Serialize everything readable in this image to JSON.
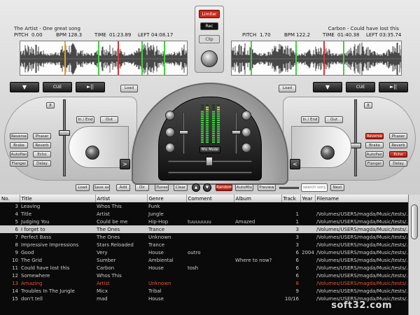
{
  "deck_left": {
    "song": "The Artist - One great song",
    "pitch_label": "PITCH",
    "pitch_value": "0.00",
    "bpm_label": "BPM",
    "bpm_value": "128.3",
    "time_label": "TIME",
    "time_value": "01:23.89",
    "left_label": "LEFT",
    "left_value": "04:08.17",
    "transport": {
      "eject": "▼",
      "cue": "CUE",
      "play": "►||",
      "load": "Load"
    },
    "cue_small": "8",
    "inout": {
      "in_end": "In / End",
      "out": "Out"
    },
    "effects_left": [
      "Reverse",
      "Brake",
      "AutoPan",
      "Flanger"
    ],
    "effects_right": [
      "Phaser",
      "Reverb",
      "Echo",
      "Delay"
    ],
    "nudge": ">"
  },
  "deck_right": {
    "song": "Carbon - Could have lost this",
    "pitch_label": "PITCH",
    "pitch_value": "1.70",
    "bpm_label": "BPM",
    "bpm_value": "122.2",
    "time_label": "TIME",
    "time_value": "01:40.38",
    "left_label": "LEFT",
    "left_value": "03:35.74",
    "transport": {
      "eject": "▼",
      "cue": "CUE",
      "play": "►||",
      "load": "Load"
    },
    "cue_small": "8",
    "inout": {
      "in_end": "In / End",
      "out": "Out"
    },
    "effects_left": [
      "Reverse",
      "Brake",
      "AutoPan",
      "Flanger"
    ],
    "effects_right": [
      "Phaser",
      "Reverb",
      "Echo",
      "Delay"
    ],
    "effects_active": [
      "Reverse",
      "Echo"
    ],
    "nudge": "<"
  },
  "center": {
    "limiter": "Limiter",
    "rec": "Rec",
    "clip": "Clip",
    "mic_mode": "Mic Mode"
  },
  "toolbar": {
    "load": "Load",
    "save": "Save as",
    "add": "Add",
    "dir": "Dir",
    "itunes": "iTunes",
    "clear": "Clear",
    "up": "▲",
    "down": "▼",
    "random": "Random",
    "automix": "AutoMix",
    "preview": "Preview",
    "search_placeholder": "search song",
    "next": "Next"
  },
  "playlist": {
    "columns": [
      "No.",
      "Title",
      "Artist",
      "Genre",
      "Comment",
      "Album",
      "Track",
      "Year",
      "Filename"
    ],
    "rows": [
      {
        "no": "3",
        "title": "Leaving",
        "artist": "Whos This",
        "genre": "Funk",
        "comment": "",
        "album": "",
        "track": "",
        "year": "",
        "file": ""
      },
      {
        "no": "4",
        "title": "Title",
        "artist": "Artist",
        "genre": "Jungle",
        "comment": "",
        "album": "",
        "track": "1",
        "year": "",
        "file": "/Volumes/USERS/magda/Music/tests/..."
      },
      {
        "no": "5",
        "title": "Judging You",
        "artist": "Could be me",
        "genre": "Hip-Hop",
        "comment": "tuuuuuuu",
        "album": "Amazed",
        "track": "1",
        "year": "",
        "file": "/Volumes/USERS/magda/Music/tests/..."
      },
      {
        "no": "6",
        "title": "I forget to",
        "artist": "The Ones",
        "genre": "Trance",
        "comment": "",
        "album": "",
        "track": "3",
        "year": "",
        "file": "/Volumes/USERS/magda/Music/tests/..."
      },
      {
        "no": "7",
        "title": "Perfect Bass",
        "artist": "The Ones",
        "genre": "Unknown",
        "comment": "",
        "album": "",
        "track": "3",
        "year": "",
        "file": "/Volumes/USERS/magda/Music/tests/..."
      },
      {
        "no": "8",
        "title": "Impressive Impressions",
        "artist": "Stars Reloaded",
        "genre": "Trance",
        "comment": "",
        "album": "",
        "track": "3",
        "year": "",
        "file": "/Volumes/USERS/magda/Music/tests/..."
      },
      {
        "no": "9",
        "title": "Good",
        "artist": "Very",
        "genre": "House",
        "comment": "outro",
        "album": "",
        "track": "6",
        "year": "2004",
        "file": "/Volumes/USERS/magda/Music/tests/..."
      },
      {
        "no": "10",
        "title": "The Grid",
        "artist": "Sumber",
        "genre": "Ambiental",
        "comment": "",
        "album": "Where to now?",
        "track": "6",
        "year": "",
        "file": "/Volumes/USERS/magda/Music/tests/..."
      },
      {
        "no": "11",
        "title": "Could have lost this",
        "artist": "Carbon",
        "genre": "House",
        "comment": "tosh",
        "album": "",
        "track": "6",
        "year": "",
        "file": "/Volumes/USERS/magda/Music/tests/..."
      },
      {
        "no": "12",
        "title": "Somewhere",
        "artist": "Whos This",
        "genre": "",
        "comment": "",
        "album": "",
        "track": "6",
        "year": "",
        "file": "/Volumes/USERS/magda/Music/tests/..."
      },
      {
        "no": "13",
        "title": "Amazing",
        "artist": "Artist",
        "genre": "Unknown",
        "comment": "",
        "album": "",
        "track": "8",
        "year": "",
        "file": "/Volumes/USERS/magda/Music/tests/..."
      },
      {
        "no": "14",
        "title": "Troubles In The Jungle",
        "artist": "Micx",
        "genre": "Tribal",
        "comment": "",
        "album": "",
        "track": "9",
        "year": "",
        "file": "/Volumes/USERS/magda/Music/tests/..."
      },
      {
        "no": "15",
        "title": "don't tell",
        "artist": "mad",
        "genre": "House",
        "comment": "",
        "album": "",
        "track": "10/16",
        "year": "",
        "file": "/Volumes/USERS/magda/Music/tests/..."
      }
    ],
    "selected_row": 3,
    "playing_row": 10
  },
  "watermark": "soft32.com",
  "colors": {
    "accent_red": "#c9281c",
    "led_green": "#3fd13f",
    "wave": "#1a1a1a"
  }
}
